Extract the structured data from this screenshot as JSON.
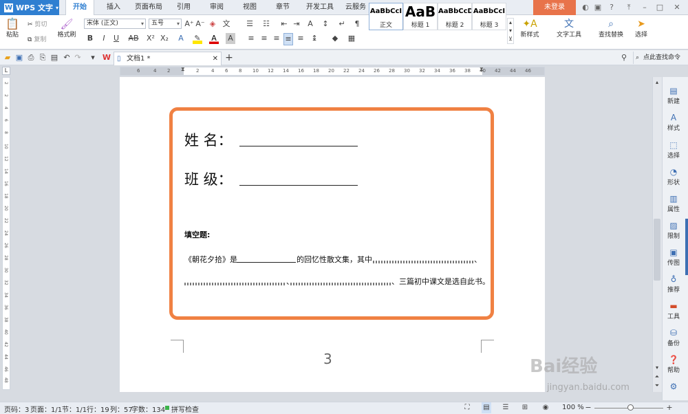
{
  "app": {
    "name": "WPS 文字",
    "login": "未登录"
  },
  "tabs": [
    "开始",
    "插入",
    "页面布局",
    "引用",
    "审阅",
    "视图",
    "章节",
    "开发工具",
    "云服务"
  ],
  "ribbon": {
    "paste": "粘贴",
    "cut": "剪切",
    "copy": "复制",
    "format_painter": "格式刷",
    "font": "宋体 (正文)",
    "size": "五号",
    "styles": [
      {
        "preview": "AaBbCcI",
        "name": "正文"
      },
      {
        "preview": "AaB",
        "name": "标题 1"
      },
      {
        "preview": "AaBbCcDd",
        "name": "标题 2"
      },
      {
        "preview": "AaBbCcI",
        "name": "标题 3"
      }
    ],
    "new_style": "新样式",
    "text_tools": "文字工具",
    "find_replace": "查找替换",
    "select": "选择"
  },
  "doc_tab": "文档1 *",
  "search_cmd": "点此查找命令",
  "ruler_top": [
    "6",
    "4",
    "2",
    "2",
    "4",
    "6",
    "8",
    "10",
    "12",
    "14",
    "16",
    "18",
    "20",
    "22",
    "24",
    "26",
    "28",
    "30",
    "32",
    "34",
    "36",
    "38",
    "40",
    "42",
    "44",
    "46"
  ],
  "ruler_left": [
    "2",
    "2",
    "4",
    "6",
    "8",
    "10",
    "12",
    "14",
    "16",
    "18",
    "20",
    "22",
    "24",
    "26",
    "28",
    "30",
    "32",
    "34",
    "36",
    "38",
    "40",
    "42",
    "44",
    "46",
    "48",
    "50",
    "52"
  ],
  "document": {
    "name_label": "姓  名：",
    "class_label": "班  级：",
    "section": "填空题:",
    "line1_a": "《朝花夕拾》是",
    "line1_b": "的回忆性散文集，其中",
    "line1_c": "、",
    "line2_a": "、",
    "line2_b": "、三篇初中课文是选自此书。",
    "page_number": "3"
  },
  "side_panel": [
    "新建",
    "样式",
    "选择",
    "形状",
    "属性",
    "限制",
    "传图",
    "推荐",
    "工具",
    "备份",
    "帮助"
  ],
  "status": {
    "page_code": "页码：3",
    "pages": "页面：1/1",
    "section": "节：1/1",
    "row": "行：19",
    "col": "列：57",
    "words": "字数：134",
    "spell": "拼写检查",
    "zoom": "100 %"
  },
  "watermark": {
    "brand": "Bai经验",
    "url": "jingyan.baidu.com"
  }
}
